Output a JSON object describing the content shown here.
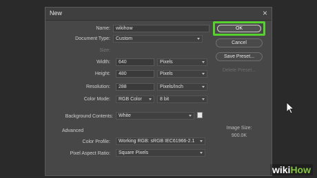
{
  "dialog": {
    "title": "New",
    "close_glyph": "×"
  },
  "form": {
    "name_label": "Name:",
    "name_value": "wikihow",
    "document_type_label": "Document Type:",
    "document_type_value": "Custom",
    "size_label": "Size:",
    "width_label": "Width:",
    "width_value": "640",
    "width_unit": "Pixels",
    "height_label": "Height:",
    "height_value": "480",
    "height_unit": "Pixels",
    "resolution_label": "Resolution:",
    "resolution_value": "288",
    "resolution_unit": "Pixels/Inch",
    "color_mode_label": "Color Mode:",
    "color_mode_value": "RGB Color",
    "bit_depth_value": "8 bit",
    "background_contents_label": "Background Contents:",
    "background_contents_value": "White",
    "advanced_label": "Advanced",
    "color_profile_label": "Color Profile:",
    "color_profile_value": "Working RGB:  sRGB IEC61966-2.1",
    "pixel_aspect_label": "Pixel Aspect Ratio:",
    "pixel_aspect_value": "Square Pixels"
  },
  "buttons": {
    "ok": "OK",
    "cancel": "Cancel",
    "save_preset": "Save Preset...",
    "delete_preset": "Delete Preset..."
  },
  "image_size": {
    "label": "Image Size:",
    "value": "900.0K"
  },
  "watermark": {
    "wiki": "wiki",
    "how": "How"
  },
  "colors": {
    "highlight": "#58d32e",
    "dialog_bg": "#474747",
    "watermark_accent": "#84c441"
  }
}
